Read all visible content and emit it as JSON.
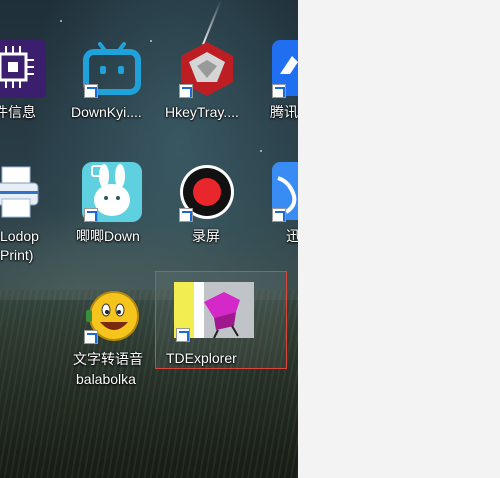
{
  "icons": [
    {
      "label_lines": [
        "件信息"
      ]
    },
    {
      "label_lines": [
        "DownKyi...."
      ]
    },
    {
      "label_lines": [
        "HkeyTray...."
      ]
    },
    {
      "label_lines": [
        "腾讯"
      ]
    },
    {
      "label_lines": [
        "Lodop",
        "Print)"
      ]
    },
    {
      "label_lines": [
        "唧唧Down"
      ]
    },
    {
      "label_lines": [
        "录屏"
      ]
    },
    {
      "label_lines": [
        "迅"
      ]
    },
    {
      "label_lines": [
        "文字转语音",
        "balabolka"
      ]
    },
    {
      "label_lines": [
        "TDExplorer"
      ]
    }
  ]
}
